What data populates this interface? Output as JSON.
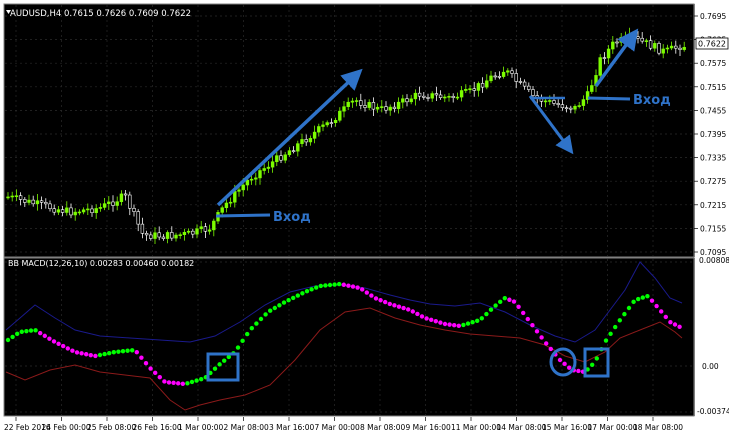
{
  "main": {
    "title": "AUDUSD,H4  0.7615 0.7626 0.7609 0.7622",
    "current_price": "0.7622",
    "price_levels": [
      "0.7695",
      "0.7635",
      "0.7575",
      "0.7515",
      "0.7455",
      "0.7395",
      "0.7335",
      "0.7275",
      "0.7215",
      "0.7155",
      "0.7095"
    ],
    "annotations": [
      "Вход",
      "Вход"
    ]
  },
  "macd": {
    "title": "BB MACD(12,26,10) 0.00283 0.00460 0.00182",
    "levels": [
      "0.00808",
      "0.00",
      "-0.00374"
    ]
  },
  "time_axis": [
    "22 Feb 2016",
    "24 Feb 00:00",
    "25 Feb 08:00",
    "26 Feb 16:00",
    "1 Mar 00:00",
    "2 Mar 08:00",
    "3 Mar 16:00",
    "7 Mar 00:00",
    "8 Mar 08:00",
    "9 Mar 16:00",
    "11 Mar 00:00",
    "14 Mar 08:00",
    "15 Mar 16:00",
    "17 Mar 00:00",
    "18 Mar 08:00"
  ],
  "colors": {
    "background": "#000000",
    "bull_candle": "#7CFC00",
    "bear_candle": "#ffffff",
    "grid": "#2a2a2a",
    "bb_upper": "#1a1a8c",
    "bb_lower": "#8b1a1a",
    "macd_up": "#00ff00",
    "macd_down": "#ff00ff",
    "annotation": "#2f73c9"
  }
}
